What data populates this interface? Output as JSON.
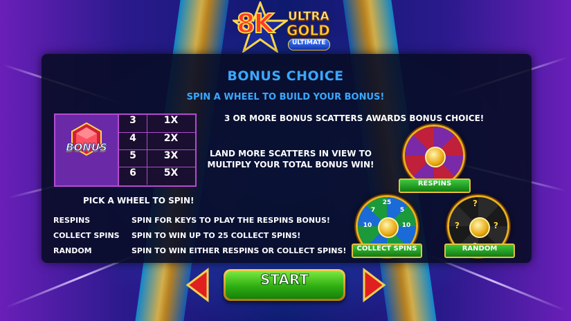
{
  "logo": {
    "number": "8K",
    "line1": "ULTRA",
    "line2": "GOLD",
    "line3": "ULTIMATE"
  },
  "header": {
    "title": "BONUS CHOICE",
    "subtitle": "SPIN A WHEEL TO BUILD YOUR BONUS!"
  },
  "paytable": {
    "symbol_label": "BONUS",
    "rows": [
      {
        "count": "3",
        "multiplier": "1X"
      },
      {
        "count": "4",
        "multiplier": "2X"
      },
      {
        "count": "5",
        "multiplier": "3X"
      },
      {
        "count": "6",
        "multiplier": "5X"
      }
    ]
  },
  "info": {
    "scatter_text": "3 OR MORE BONUS SCATTERS AWARDS BONUS CHOICE!",
    "multiply_line1": "LAND MORE SCATTERS IN VIEW TO",
    "multiply_line2": "MULTIPLY YOUR TOTAL BONUS WIN!",
    "pick_heading": "PICK A WHEEL TO SPIN!",
    "options": [
      {
        "name": "RESPINS",
        "description": "SPIN FOR KEYS TO PLAY THE RESPINS BONUS!"
      },
      {
        "name": "COLLECT SPINS",
        "description": "SPIN TO WIN UP TO 25 COLLECT SPINS!"
      },
      {
        "name": "RANDOM",
        "description": "SPIN TO WIN EITHER RESPINS OR COLLECT SPINS!"
      }
    ]
  },
  "wheels": {
    "respins": {
      "label": "RESPINS",
      "colors": [
        "#c0203a",
        "#7a2aa8"
      ]
    },
    "collect_spins": {
      "label": "COLLECT SPINS",
      "colors": [
        "#1a6ad8",
        "#1a9a3a"
      ],
      "segment_values": [
        "25",
        "10",
        "7",
        "5",
        "10"
      ]
    },
    "random": {
      "label": "RANDOM",
      "colors": [
        "#1a1a1a",
        "#2a2a2a"
      ],
      "symbol": "?"
    }
  },
  "controls": {
    "start_label": "START",
    "prev_icon": "left-arrow-icon",
    "next_icon": "right-arrow-icon",
    "accent": "#e8b020"
  }
}
